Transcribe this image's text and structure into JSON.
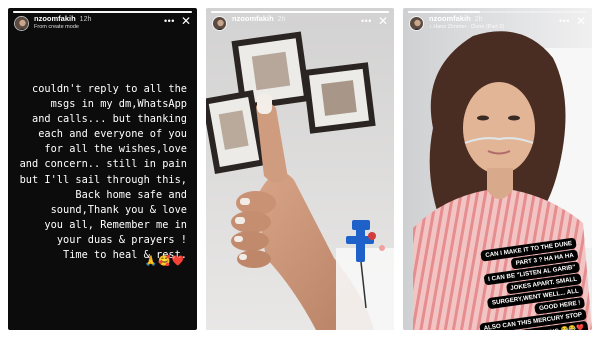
{
  "stories": [
    {
      "id": "story1",
      "progress": 1.0,
      "username": "nzoomfakih",
      "time": "12h",
      "subtitle": "From create mode",
      "icons": {
        "more": "more-icon",
        "close": "close-icon"
      },
      "text": "couldn't reply to all the\nmsgs in my dm,WhatsApp\nand calls... but thanking\neach and everyone of you\nfor all the wishes,love\nand concern.. still in pain\nbut I'll sail through this,\nBack home safe and\nsound,Thank you & love\nyou all, Remember me in\nyour duas & prayers !\nTime to heal & rest.",
      "emojis": "🙏🥰❤️"
    },
    {
      "id": "story2",
      "progress": 1.0,
      "username": "nzoomfakih",
      "time": "2h",
      "subtitle": "",
      "icons": {
        "more": "more-icon",
        "close": "close-icon"
      }
    },
    {
      "id": "story3",
      "progress": 0.4,
      "username": "nzoomfakih",
      "time": "2h",
      "subtitle": "Hans Zimmer · Dune (Part 2)",
      "icons": {
        "more": "more-icon",
        "close": "close-icon"
      },
      "caption_lines": [
        "CAN I MAKE IT TO THE DUNE",
        "PART 3 ? HA HA HA",
        "I CAN BE \"LISTEN AL GARIB\"",
        "JOKES APART. SMALL",
        "SURGERY,WENT WELL... ALL",
        "GOOD HERE !",
        "ALSO CAN THIS MERCURY STOP",
        "BEING RETROGRADING 😂😂❤️"
      ]
    }
  ],
  "colors": {
    "story1_bg": "#0c0c0c",
    "caption_bg": "#000000",
    "caption_text": "#ffffff",
    "text": "#ffffff"
  }
}
